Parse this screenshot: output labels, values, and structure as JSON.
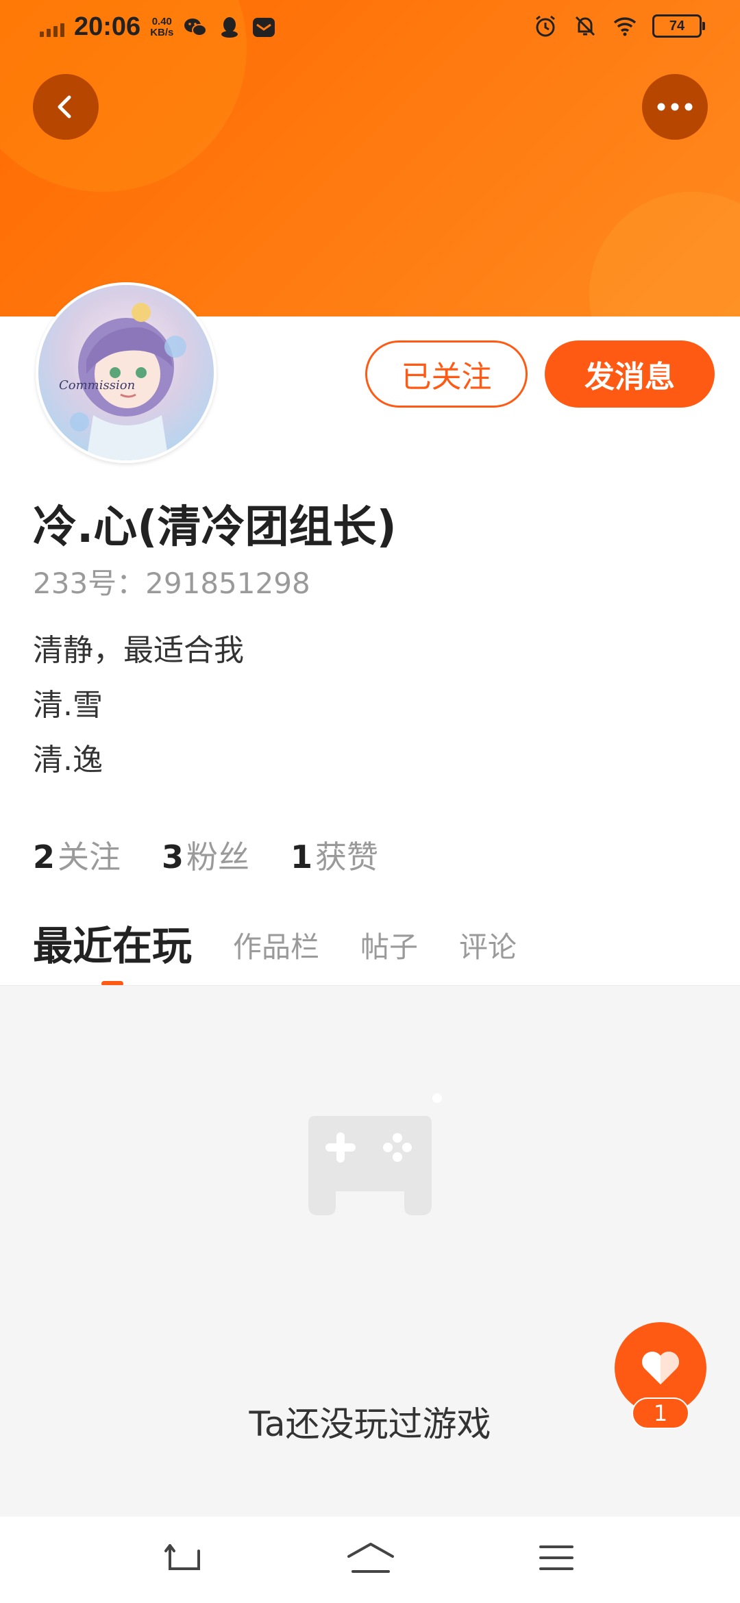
{
  "status_bar": {
    "time": "20:06",
    "net_speed_value": "0.40",
    "net_speed_unit": "KB/s",
    "battery": "74",
    "left_icons": [
      "wechat-icon",
      "qq-icon",
      "mail-app-icon"
    ],
    "right_icons": [
      "alarm-icon",
      "mute-bell-icon",
      "wifi-icon"
    ]
  },
  "header": {
    "accent": "#ff6a00",
    "back_icon": "chevron-left-icon",
    "more_icon": "more-dots-icon"
  },
  "profile": {
    "avatar_watermark": "Commission",
    "follow_label": "已关注",
    "message_label": "发消息",
    "username": "冷.心(清冷团组长)",
    "id_line": "233号：291851298",
    "bio_lines": [
      "清静，最适合我",
      "清.雪",
      "清.逸"
    ]
  },
  "stats": [
    {
      "num": "2",
      "label": "关注"
    },
    {
      "num": "3",
      "label": "粉丝"
    },
    {
      "num": "1",
      "label": "获赞"
    }
  ],
  "tabs": [
    {
      "label": "最近在玩",
      "active": true
    },
    {
      "label": "作品栏",
      "active": false
    },
    {
      "label": "帖子",
      "active": false
    },
    {
      "label": "评论",
      "active": false
    }
  ],
  "empty_state": {
    "icon": "gamepad-icon",
    "text": "Ta还没玩过游戏"
  },
  "like_fab": {
    "icon": "heart-icon",
    "count": "1",
    "color": "#ff5a14"
  },
  "nav": {
    "icons": [
      "back-nav-icon",
      "home-nav-icon",
      "menu-nav-icon"
    ]
  }
}
